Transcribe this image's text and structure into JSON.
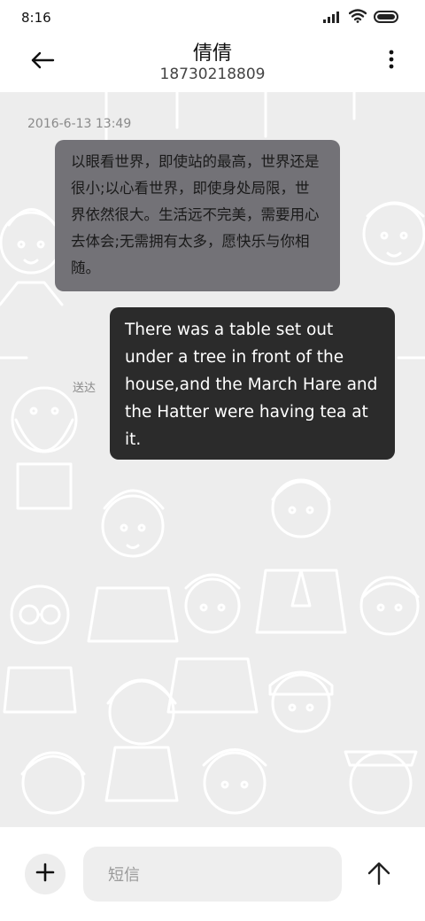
{
  "status_bar": {
    "time": "8:16",
    "icons": [
      "signal-icon",
      "wifi-icon",
      "battery-icon"
    ]
  },
  "header": {
    "back_icon": "arrow-left-icon",
    "contact_name": "倩倩",
    "contact_number": "18730218809",
    "more_icon": "more-vertical-icon"
  },
  "conversation": {
    "timestamp": "2016-6-13 13:49",
    "messages": [
      {
        "direction": "incoming",
        "text": "以眼看世界，即使站的最高，世界还是很小;以心看世界，即使身处局限，世界依然很大。生活远不完美，需要用心去体会;无需拥有太多，愿快乐与你相随。"
      },
      {
        "direction": "outgoing",
        "text": "There was a table set out under a tree in front of the house,and the March Hare and the Hatter were having tea at it.",
        "status": "送达"
      }
    ]
  },
  "composer": {
    "add_icon": "plus-icon",
    "placeholder": "短信",
    "send_icon": "arrow-up-icon"
  },
  "colors": {
    "chat_background": "#ededed",
    "pattern_stroke": "#ffffff",
    "incoming_bubble": "#737277",
    "outgoing_bubble": "#2b2b2b"
  }
}
